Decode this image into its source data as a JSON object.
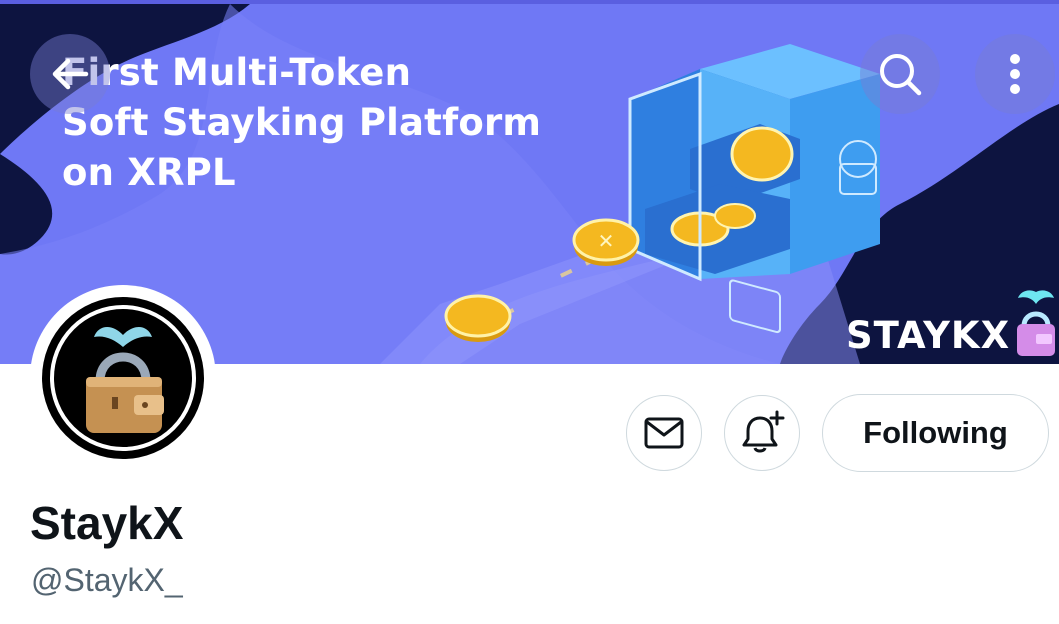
{
  "banner": {
    "headline_lines": [
      "First Multi-Token",
      "Soft Stayking Platform",
      "on XRPL"
    ],
    "brand_text": "STAYKX"
  },
  "nav": {
    "back_icon": "arrow-left-icon",
    "search_icon": "search-icon",
    "more_icon": "more-vertical-icon"
  },
  "actions": {
    "message_icon": "envelope-icon",
    "notify_icon": "bell-plus-icon",
    "follow_label": "Following"
  },
  "profile": {
    "name": "StaykX",
    "handle": "@StaykX_"
  },
  "colors": {
    "banner_blue": "#6f78f5",
    "banner_dark": "#0d1440",
    "coin_gold": "#f4b820",
    "safe_blue": "#3aa0ee",
    "text_primary": "#0f1419",
    "text_secondary": "#536471",
    "border": "#cfd9de"
  }
}
